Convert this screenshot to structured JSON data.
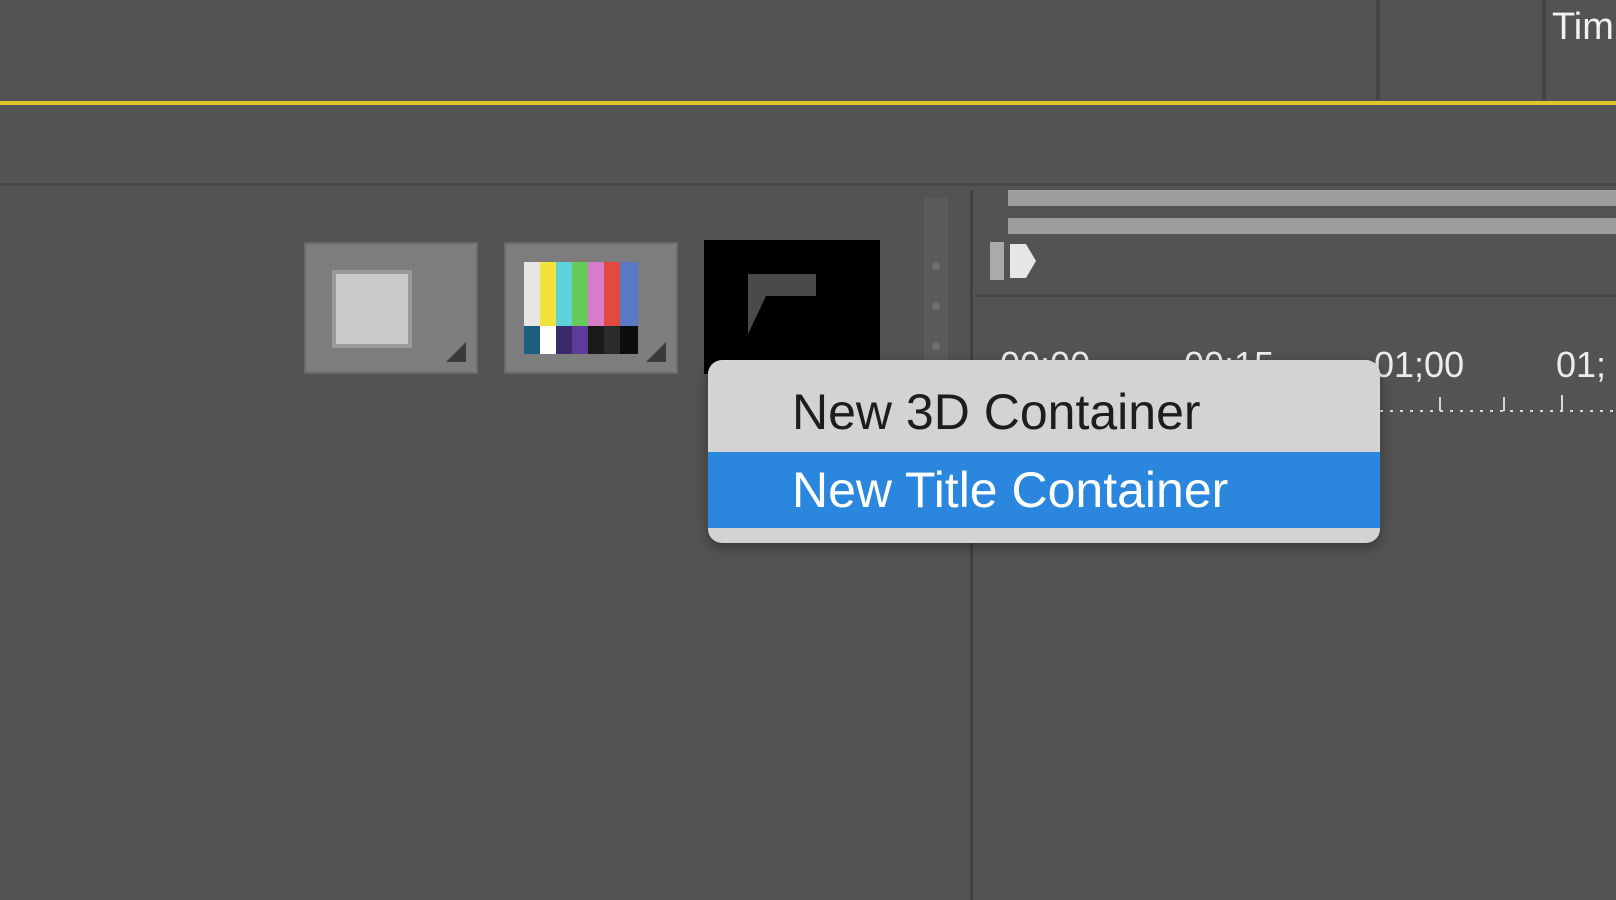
{
  "header": {
    "tab_title": "Tim"
  },
  "colors": {
    "background": "#535353",
    "accent_line": "#e2c52a",
    "menu_background": "#d3d3d3",
    "menu_highlight": "#2b86de"
  },
  "thumbnails": [
    {
      "name": "solid-color-thumbnail",
      "icon": "square-icon"
    },
    {
      "name": "color-bars-thumbnail",
      "icon": "color-bars-icon"
    },
    {
      "name": "title-thumbnail",
      "icon": "title-frame-icon"
    }
  ],
  "timeline": {
    "tick_labels": [
      "00;00",
      "00;15",
      "01;00",
      "01;"
    ]
  },
  "context_menu": {
    "items": [
      {
        "label": "New 3D Container",
        "highlighted": false
      },
      {
        "label": "New Title Container",
        "highlighted": true
      }
    ]
  }
}
